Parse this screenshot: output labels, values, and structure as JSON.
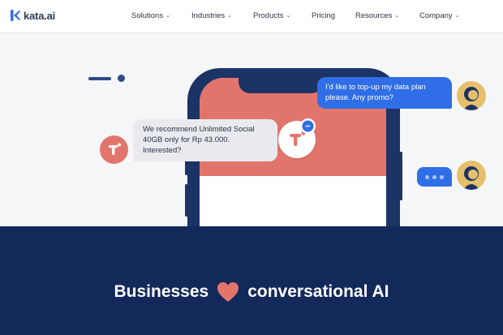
{
  "brand": {
    "name": "kata.ai",
    "color": "#2f6ee6"
  },
  "nav": [
    {
      "label": "Solutions",
      "has_dropdown": true
    },
    {
      "label": "Industries",
      "has_dropdown": true
    },
    {
      "label": "Products",
      "has_dropdown": true
    },
    {
      "label": "Pricing",
      "has_dropdown": false
    },
    {
      "label": "Resources",
      "has_dropdown": true
    },
    {
      "label": "Company",
      "has_dropdown": true
    }
  ],
  "chat": {
    "user_message": "I'd like to top-up my data plan please. Any promo?",
    "bot_message": "We recommend Unlimited Social 40GB only for Rp 43.000. Interested?"
  },
  "tagline": {
    "before": "Businesses",
    "after": "conversational AI",
    "icon": "heart-icon"
  },
  "colors": {
    "navy": "#13295a",
    "phone": "#1c3366",
    "coral": "#e2756b",
    "blue": "#2f6ee6",
    "avatar": "#e6bf6b"
  }
}
